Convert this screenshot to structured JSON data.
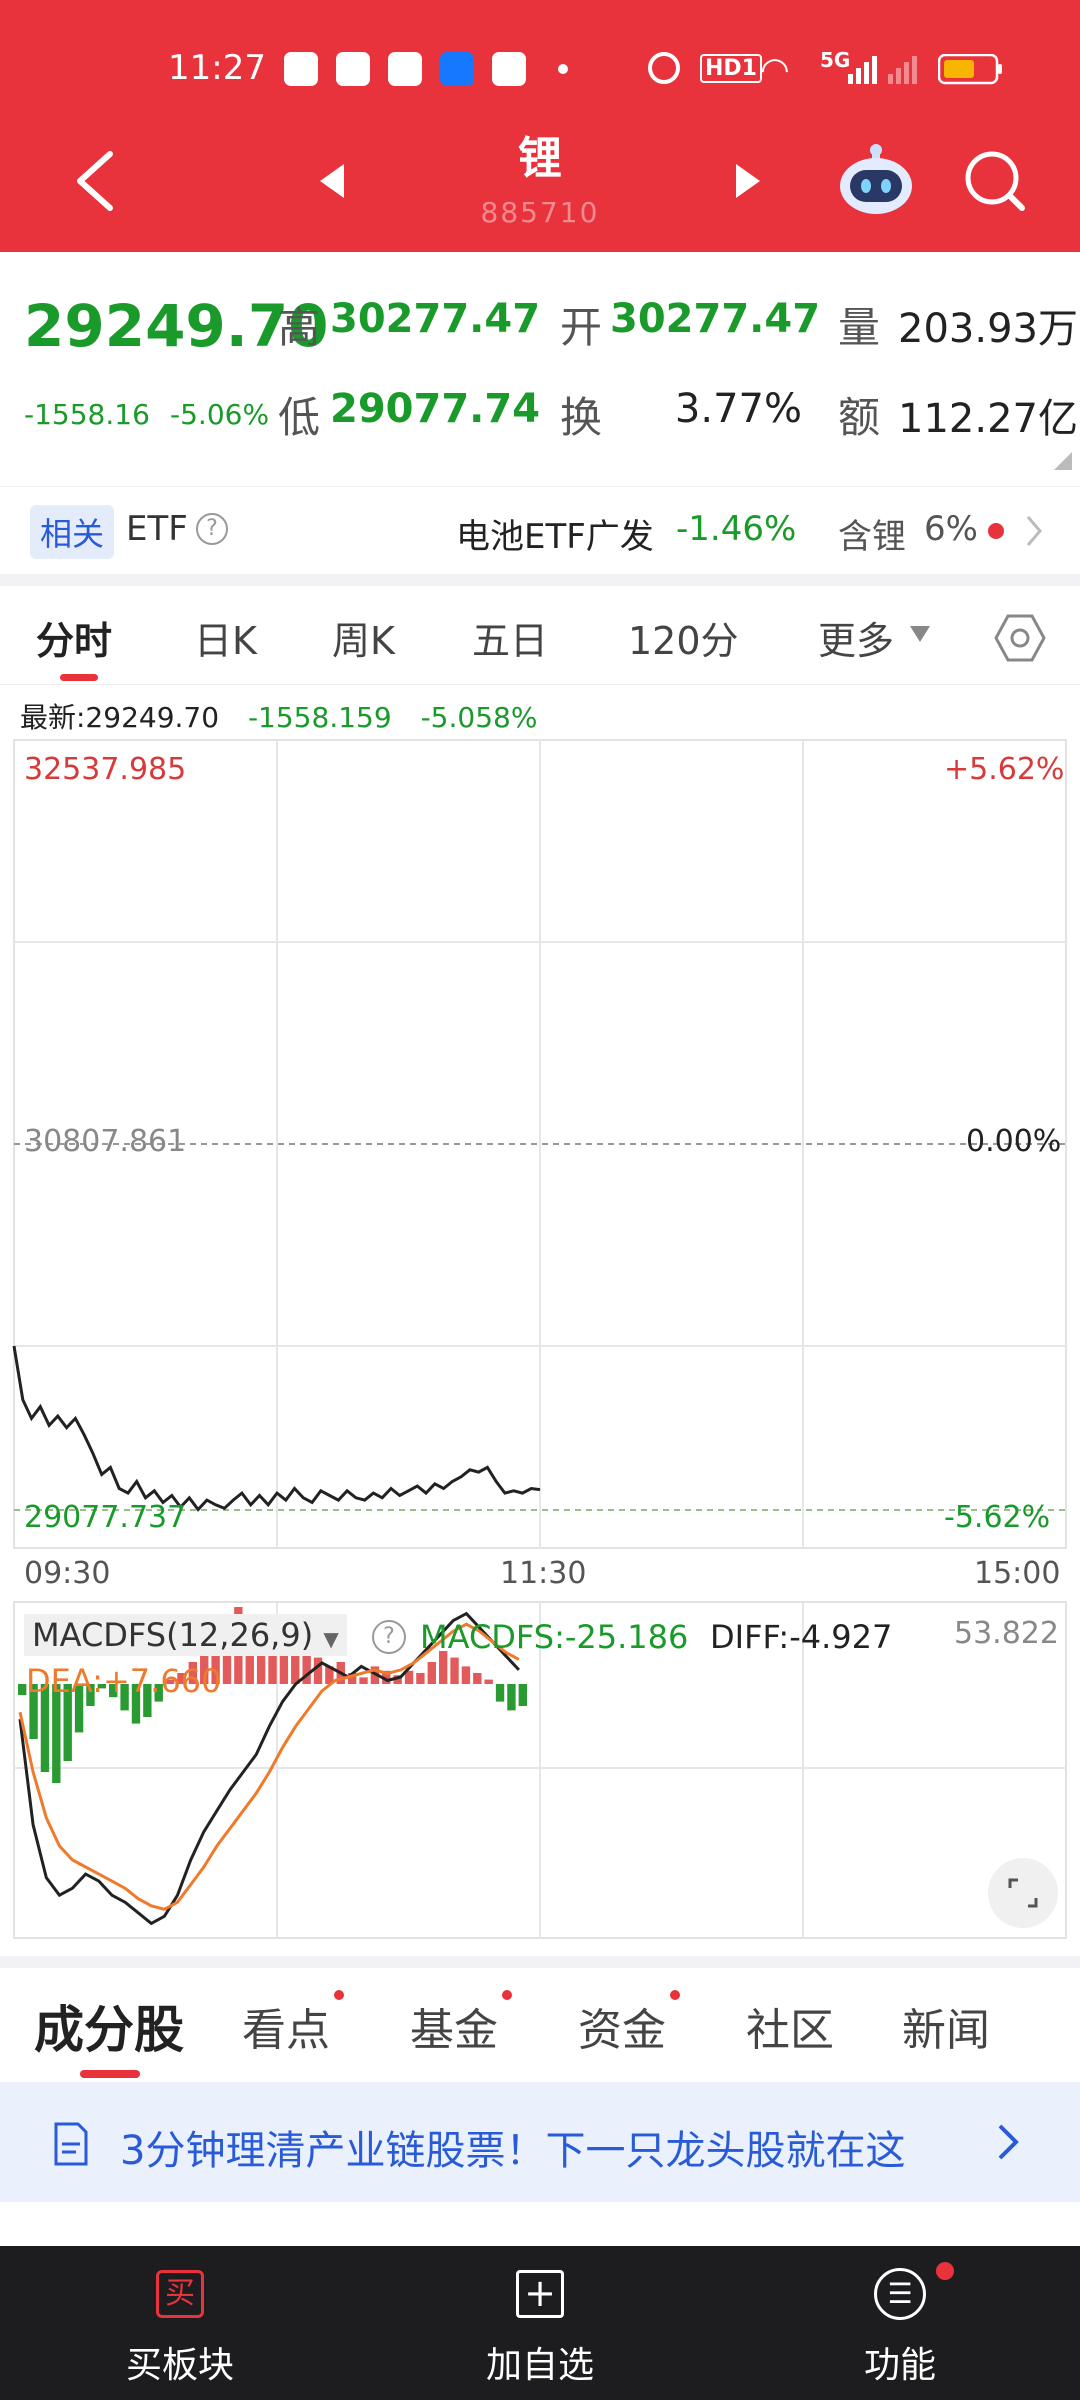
{
  "status_bar": {
    "time": "11:27",
    "network": "5G",
    "hd_label": "HD1"
  },
  "header": {
    "title": "锂",
    "subtitle": "885710"
  },
  "quote": {
    "price": "29249.70",
    "change": "-1558.16",
    "change_pct": "-5.06%",
    "high_label": "高",
    "high": "30277.47",
    "open_label": "开",
    "open": "30277.47",
    "volume_label": "量",
    "volume": "203.93万",
    "low_label": "低",
    "low": "29077.74",
    "turnover_label": "换",
    "turnover": "3.77%",
    "amount_label": "额",
    "amount": "112.27亿"
  },
  "etf": {
    "tag": "相关",
    "label": "ETF",
    "name": "电池ETF广发",
    "change": "-1.46%",
    "holding_label": "含锂",
    "holding": "6%"
  },
  "tabs": [
    "分时",
    "日K",
    "周K",
    "五日",
    "120分",
    "更多"
  ],
  "chart_info": {
    "latest_label": "最新:29249.70",
    "change": "-1558.159",
    "change_pct": "-5.058%"
  },
  "colors": {
    "accent": "#e8323c",
    "down": "#1a9a2a",
    "up": "#d83a3a",
    "link": "#2a5bd7"
  },
  "chart_data": [
    {
      "type": "line",
      "x_ticks": [
        "09:30",
        "11:30",
        "15:00"
      ],
      "y_left_ticks": [
        "32537.985",
        "30807.861",
        "29077.737"
      ],
      "y_right_ticks": [
        "+5.62%",
        "0.00%",
        "-5.62%"
      ],
      "ylim": [
        29077.737,
        32537.985
      ],
      "x": [
        0,
        2,
        4,
        6,
        8,
        10,
        12,
        14,
        16,
        18,
        20,
        22,
        24,
        26,
        28,
        30,
        32,
        34,
        36,
        38,
        40,
        42,
        44,
        46,
        48,
        50,
        52,
        54,
        56,
        58,
        60,
        62,
        64,
        66,
        68,
        70,
        72,
        74,
        76,
        78,
        80,
        82,
        84,
        86,
        88,
        90,
        92,
        94,
        96,
        98,
        100,
        102,
        104,
        106,
        108,
        110,
        112,
        114,
        116,
        118,
        120
      ],
      "values": [
        29780,
        29550,
        29470,
        29520,
        29440,
        29480,
        29430,
        29470,
        29400,
        29320,
        29230,
        29260,
        29170,
        29150,
        29200,
        29130,
        29160,
        29110,
        29140,
        29090,
        29130,
        29080,
        29120,
        29100,
        29085,
        29120,
        29150,
        29100,
        29140,
        29100,
        29150,
        29120,
        29170,
        29130,
        29110,
        29160,
        29140,
        29120,
        29160,
        29130,
        29120,
        29150,
        29130,
        29170,
        29140,
        29160,
        29180,
        29150,
        29190,
        29170,
        29200,
        29220,
        29250,
        29240,
        29260,
        29200,
        29150,
        29160,
        29150,
        29170,
        29165
      ]
    },
    {
      "type": "bar",
      "title": "MACDFS(12,26,9)",
      "legend": [
        "MACDFS:-25.186",
        "DIFF:-4.927",
        "DEA:+7.660"
      ],
      "y_top_label": "53.822",
      "macd": [
        -5,
        -25,
        -40,
        -45,
        -35,
        -22,
        -10,
        -2,
        -6,
        -12,
        -18,
        -15,
        -8,
        2,
        5,
        10,
        15,
        22,
        28,
        35,
        30,
        25,
        28,
        20,
        15,
        18,
        12,
        8,
        10,
        5,
        3,
        8,
        6,
        4,
        6,
        5,
        10,
        15,
        12,
        8,
        5,
        2,
        -8,
        -12,
        -10
      ],
      "diff": [
        -10,
        -40,
        -55,
        -60,
        -58,
        -54,
        -56,
        -60,
        -62,
        -65,
        -68,
        -66,
        -60,
        -50,
        -42,
        -36,
        -30,
        -25,
        -20,
        -12,
        -5,
        0,
        3,
        6,
        4,
        2,
        5,
        3,
        1,
        2,
        6,
        10,
        14,
        18,
        20,
        16,
        12,
        8,
        4
      ],
      "dea": [
        -8,
        -25,
        -38,
        -46,
        -50,
        -52,
        -54,
        -56,
        -58,
        -61,
        -63,
        -64,
        -62,
        -57,
        -52,
        -46,
        -41,
        -36,
        -31,
        -25,
        -18,
        -12,
        -7,
        -2,
        1,
        2,
        3,
        4,
        3,
        4,
        6,
        9,
        12,
        15,
        17,
        15,
        12,
        9,
        7
      ]
    }
  ],
  "bottom_tabs": [
    "成分股",
    "看点",
    "基金",
    "资金",
    "社区",
    "新闻"
  ],
  "banner": {
    "text": "3分钟理清产业链股票！下一只龙头股就在这"
  },
  "bottom_nav": [
    {
      "label": "买板块",
      "icon_char": "买"
    },
    {
      "label": "加自选",
      "icon_char": "+"
    },
    {
      "label": "功能",
      "icon_char": "☰"
    }
  ]
}
